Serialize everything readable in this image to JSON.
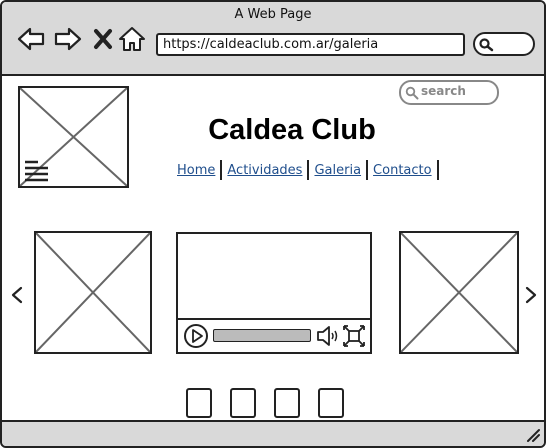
{
  "browser": {
    "window_title": "A Web Page",
    "url": "https://caldeaclub.com.ar/galeria",
    "icons": [
      "back-icon",
      "forward-icon",
      "close-icon",
      "home-icon",
      "search-icon"
    ]
  },
  "page": {
    "search_placeholder": "search",
    "site_title": "Caldea Club",
    "menu": [
      "Home",
      "Actividades",
      "Galeria",
      "Contacto"
    ]
  },
  "carousel": {
    "slides": [
      "image",
      "video",
      "image"
    ],
    "indicator_count": 4,
    "prev_icon": "chevron-left-icon",
    "next_icon": "chevron-right-icon"
  },
  "video_player": {
    "progress": 0,
    "icons": [
      "play-icon",
      "volume-icon",
      "fullscreen-icon"
    ]
  }
}
